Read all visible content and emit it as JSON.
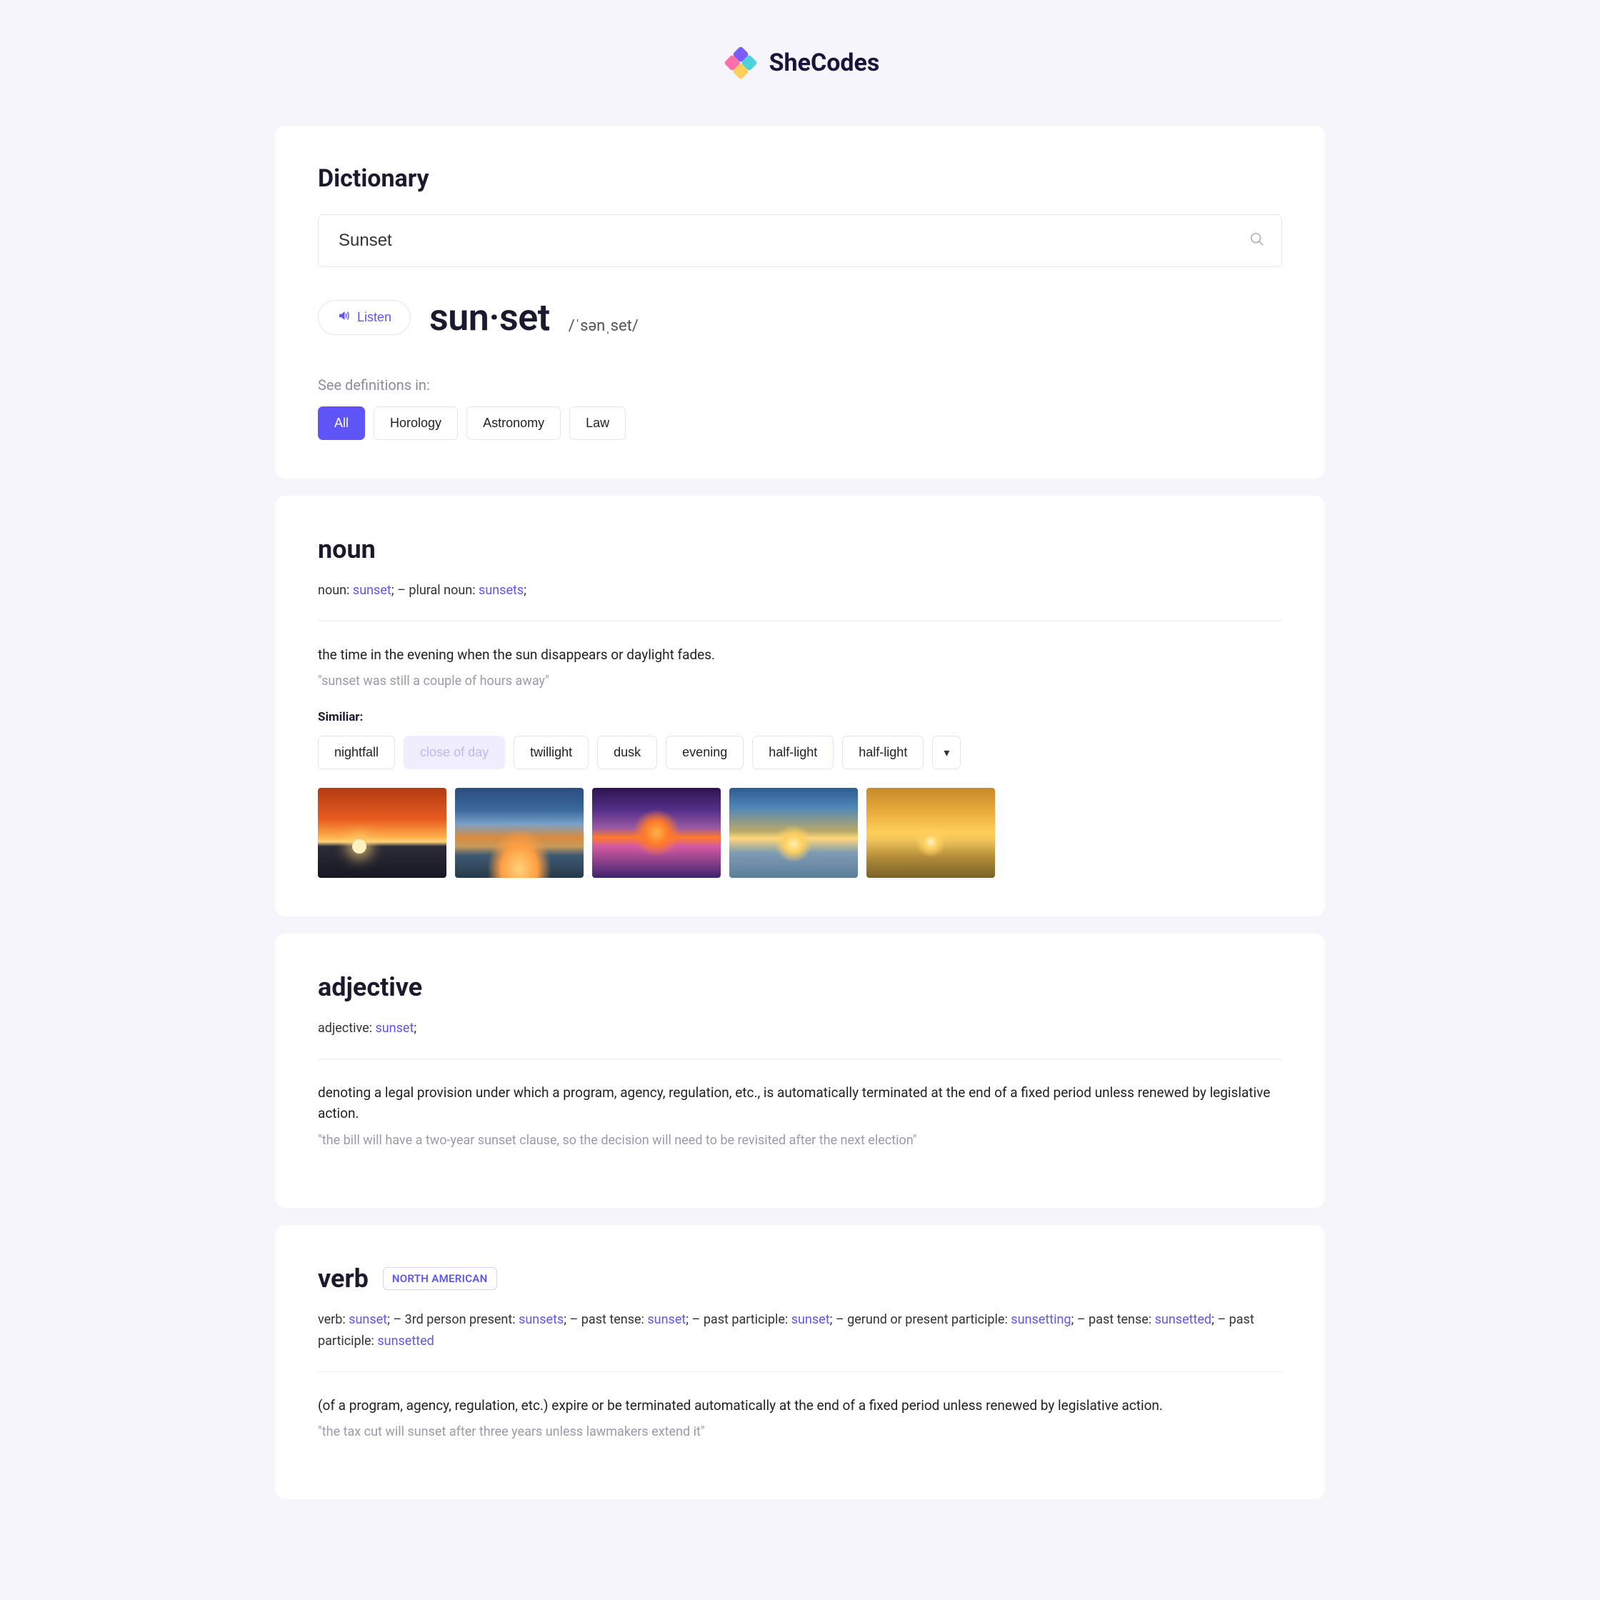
{
  "brand": {
    "name": "SheCodes"
  },
  "dictionary": {
    "title": "Dictionary",
    "search_value": "Sunset",
    "listen_label": "Listen",
    "word_display": "sun·set",
    "phonetic": "/ˈsənˌset/",
    "see_definitions_label": "See definitions in:",
    "categories": [
      "All",
      "Horology",
      "Astronomy",
      "Law"
    ],
    "active_category_index": 0
  },
  "entries": [
    {
      "pos": "noun",
      "forms_segments": [
        {
          "t": "noun: "
        },
        {
          "t": "sunset",
          "blue": true
        },
        {
          "t": ";   –   plural noun: "
        },
        {
          "t": "sunsets",
          "blue": true
        },
        {
          "t": ";"
        }
      ],
      "definition": "the time in the evening when the sun disappears or daylight fades.",
      "example": "\"sunset was still a couple of hours away\"",
      "similar_label": "Similiar:",
      "similar": [
        "nightfall",
        "close of day",
        "twillight",
        "dusk",
        "evening",
        "half-light",
        "half-light"
      ],
      "similar_muted_index": 1,
      "has_images": true
    },
    {
      "pos": "adjective",
      "forms_segments": [
        {
          "t": "adjective: "
        },
        {
          "t": "sunset",
          "blue": true
        },
        {
          "t": ";"
        }
      ],
      "definition": "denoting a legal provision under which a program, agency, regulation, etc., is automatically terminated at the end of a fixed period unless renewed by legislative action.",
      "example": "\"the bill will have a two-year sunset clause, so the decision will need to be revisited after the next election\""
    },
    {
      "pos": "verb",
      "badge": "NORTH AMERICAN",
      "forms_segments": [
        {
          "t": "verb: "
        },
        {
          "t": "sunset",
          "blue": true
        },
        {
          "t": ";   –   3rd person present: "
        },
        {
          "t": "sunsets",
          "blue": true
        },
        {
          "t": ";   –   past tense: "
        },
        {
          "t": "sunset",
          "blue": true
        },
        {
          "t": ";   –   past participle: "
        },
        {
          "t": "sunset",
          "blue": true
        },
        {
          "t": ";   –   gerund or present participle: "
        },
        {
          "t": "sunsetting",
          "blue": true
        },
        {
          "t": ";   –   past tense: "
        },
        {
          "t": "sunsetted",
          "blue": true
        },
        {
          "t": ";   –   past participle: "
        },
        {
          "t": "sunsetted",
          "blue": true
        }
      ],
      "definition": "(of a program, agency, regulation, etc.) expire or be terminated automatically at the end of a fixed period unless renewed by legislative action.",
      "example": "\"the tax cut will sunset after three years unless lawmakers extend it\""
    }
  ]
}
